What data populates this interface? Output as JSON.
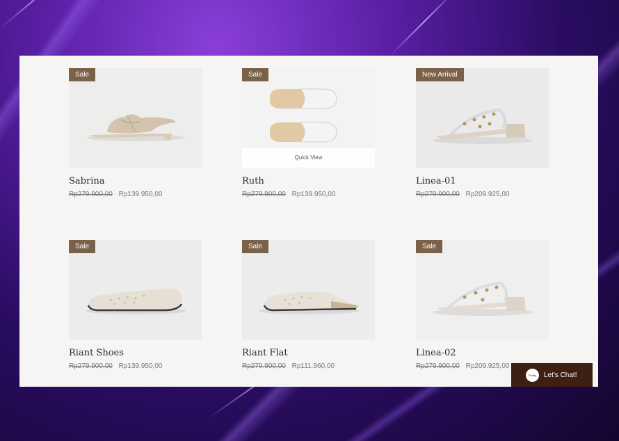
{
  "products": [
    {
      "name": "Sabrina",
      "badge": "Sale",
      "old_price": "Rp279.900,00",
      "price": "Rp139.950,00",
      "image": "knotted-mule-icon"
    },
    {
      "name": "Ruth",
      "badge": "Sale",
      "old_price": "Rp279.900,00",
      "price": "Rp139.950,00",
      "image": "slide-sandals-icon",
      "quick_view": "Quick View"
    },
    {
      "name": "Linea-01",
      "badge": "New Arrival",
      "old_price": "Rp279.900,00",
      "price": "Rp209.925,00",
      "image": "studded-heel-icon"
    },
    {
      "name": "Riant Shoes",
      "badge": "Sale",
      "old_price": "Rp279.900,00",
      "price": "Rp139.950,00",
      "image": "ballet-flat-icon"
    },
    {
      "name": "Riant Flat",
      "badge": "Sale",
      "old_price": "Rp279.900,00",
      "price": "Rp111.960,00",
      "image": "mule-flat-icon"
    },
    {
      "name": "Linea-02",
      "badge": "Sale",
      "old_price": "Rp279.900,00",
      "price": "Rp209.925,00",
      "image": "clear-heel-icon"
    }
  ],
  "chat": {
    "label": "Let's Chat!",
    "avatar_text": "Rzafly"
  },
  "colors": {
    "badge": "#7a6249",
    "chat": "#3e1f14",
    "panel": "#f6f5f4"
  }
}
